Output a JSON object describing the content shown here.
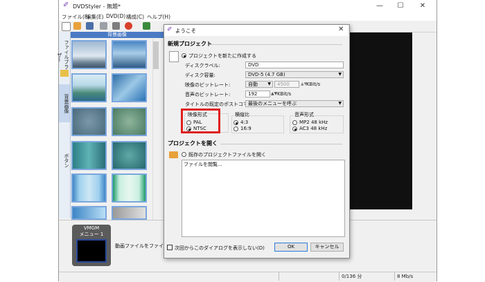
{
  "window": {
    "title": "DVDStyler - 無題*",
    "controls": {
      "minimize": "—",
      "maximize": "☐",
      "close": "✕"
    }
  },
  "menu": [
    "ファイル(F)",
    "編集(E)",
    "DVD(D)",
    "構成(C)",
    "ヘルプ(H)"
  ],
  "sidebar": {
    "tabs": [
      "ファイルブラウザー",
      "背景画像",
      "ボタン"
    ],
    "panel_title": "背景画像"
  },
  "bottom": {
    "vmgm_title": "VMGM",
    "menu_label": "メニュー 1",
    "hint": "動画ファイルをファイルブラウ"
  },
  "status": {
    "progress": "0/136 分",
    "bitrate": "8 Mb/s"
  },
  "dialog": {
    "title": "ようこそ",
    "new_project": {
      "heading": "新規プロジェクト",
      "create_option": "プロジェクトを新たに作成する",
      "fields": [
        {
          "label": "ディスクラベル:",
          "value": "DVD"
        },
        {
          "label": "ディスク容量:",
          "value": "DVD-5 (4.7 GB)"
        },
        {
          "label": "映像のビットレート:",
          "value": "自動",
          "number": "4500",
          "unit": "KBit/s"
        },
        {
          "label": "音声のビットレート:",
          "value": "192",
          "unit": "KBit/s"
        },
        {
          "label": "タイトルの既定のポストコマンド:",
          "value": "最後のメニューを呼ぶ"
        }
      ],
      "video_format": {
        "heading": "映像形式",
        "options": [
          "PAL",
          "NTSC"
        ],
        "selected": "NTSC"
      },
      "aspect": {
        "heading": "横縦比",
        "options": [
          "4:3",
          "16:9"
        ],
        "selected": "4:3"
      },
      "audio_format": {
        "heading": "音声形式",
        "options": [
          "MP2 48 kHz",
          "AC3 48 kHz"
        ],
        "selected": "AC3 48 kHz"
      }
    },
    "open_project": {
      "heading": "プロジェクトを開く",
      "open_option": "既存のプロジェクトファイルを開く",
      "list_item": "ファイルを閲覧..."
    },
    "dont_show": "次回からこのダイアログを表示しない(D)",
    "ok": "OK",
    "cancel": "キャンセル"
  },
  "colors": {
    "highlight": "#e02020",
    "panel_accent": "#4a7bc4",
    "app_icon": "#7a3fb0"
  }
}
